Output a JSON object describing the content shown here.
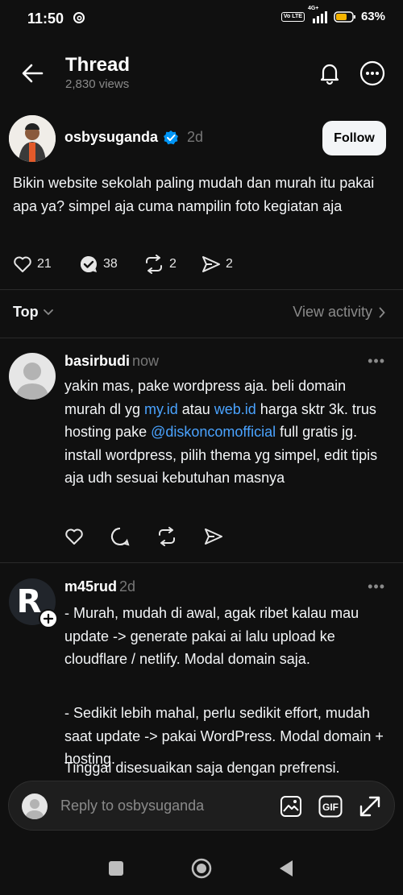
{
  "status": {
    "time": "11:50",
    "battery": "63%",
    "network": "4G+",
    "volte": "Vo LTE"
  },
  "header": {
    "title": "Thread",
    "views": "2,830 views"
  },
  "post": {
    "username": "osbysuganda",
    "time": "2d",
    "follow_label": "Follow",
    "text": "Bikin website sekolah paling mudah dan murah itu pakai apa ya? simpel aja cuma nampilin foto kegiatan aja",
    "likes": "21",
    "comments": "38",
    "reposts": "2",
    "shares": "2"
  },
  "sort": {
    "label": "Top",
    "view_activity": "View activity"
  },
  "comments": [
    {
      "username": "basirbudi",
      "time": "now",
      "text_parts": {
        "p1": "yakin mas, pake wordpress aja. beli domain murah dl yg ",
        "link1": "my.id",
        "p2": " atau ",
        "link2": "web.id",
        "p3": " harga sktr 3k. trus hosting pake ",
        "link3": "@diskoncomofficial",
        "p4": " full gratis jg. install wordpress, pilih thema yg simpel, edit tipis aja udh sesuai kebutuhan masnya"
      }
    },
    {
      "username": "m45rud",
      "time": "2d",
      "avatar_letter": "R",
      "paragraphs": [
        "- Murah, mudah di awal, agak ribet kalau mau update -> generate pakai ai lalu upload ke cloudflare / netlify. Modal domain saja.",
        "- Sedikit lebih mahal, perlu sedikit effort, mudah saat update -> pakai WordPress. Modal domain + hosting.",
        "Tinggal disesuaikan saja dengan prefrensi."
      ]
    }
  ],
  "reply": {
    "placeholder": "Reply to osbysuganda"
  },
  "colors": {
    "background": "#101010",
    "link": "#4aa3ff",
    "verified": "#0095f6"
  }
}
